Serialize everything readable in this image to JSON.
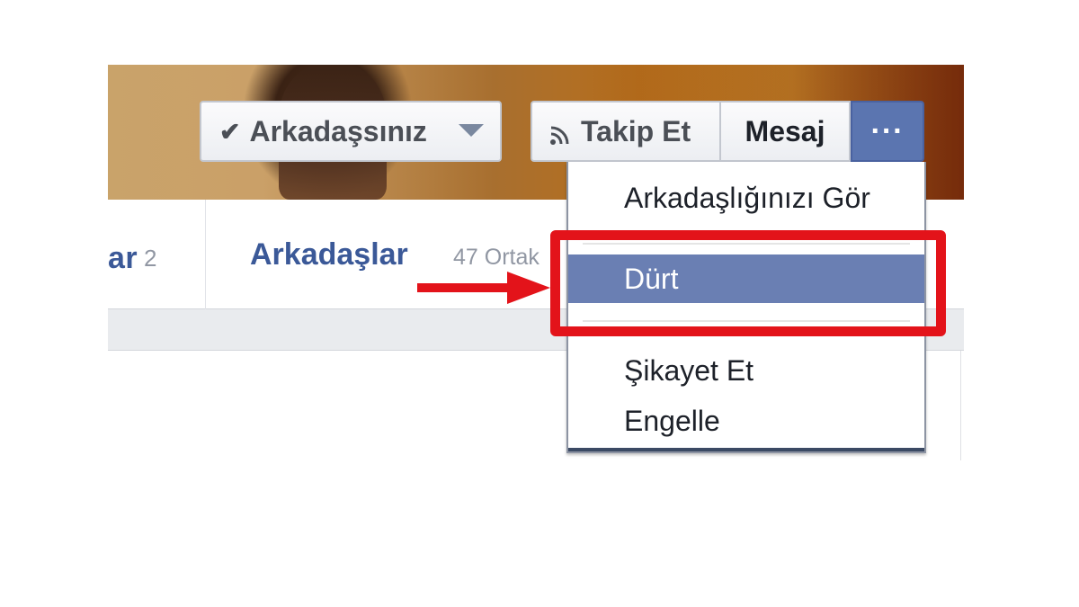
{
  "colors": {
    "facebook_blue": "#3b5998",
    "menu_highlight": "#6a7fb3",
    "annotation_red": "#e3131a"
  },
  "profile_header": {
    "friend_button": {
      "label": "Arkadaşsınız",
      "icon": "check-icon",
      "dropdown_icon": "caret-down-icon"
    },
    "follow_button": {
      "label": "Takip Et",
      "icon": "rss-icon"
    },
    "message_button": {
      "label": "Mesaj"
    },
    "more_button": {
      "label": "···"
    }
  },
  "tabs": {
    "previous_tab_fragment": "ar",
    "previous_tab_count": "2",
    "friends_tab": {
      "label": "Arkadaşlar",
      "subtitle": "47 Ortak"
    }
  },
  "dropdown_menu": {
    "items": [
      {
        "label": "Arkadaşlığınızı Gör"
      },
      {
        "label": "Dürt",
        "highlighted": true
      },
      {
        "label": "Şikayet Et"
      },
      {
        "label": "Engelle"
      }
    ]
  }
}
